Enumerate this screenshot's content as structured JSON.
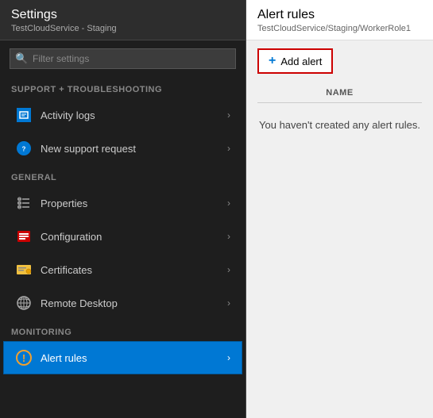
{
  "left_panel": {
    "title": "Settings",
    "subtitle": "TestCloudService - Staging",
    "search": {
      "placeholder": "Filter settings"
    },
    "sections": [
      {
        "label": "SUPPORT + TROUBLESHOOTING",
        "items": [
          {
            "id": "activity-logs",
            "label": "Activity logs",
            "icon": "activity-icon",
            "active": false
          },
          {
            "id": "new-support-request",
            "label": "New support request",
            "icon": "support-icon",
            "active": false
          }
        ]
      },
      {
        "label": "GENERAL",
        "items": [
          {
            "id": "properties",
            "label": "Properties",
            "icon": "properties-icon",
            "active": false
          },
          {
            "id": "configuration",
            "label": "Configuration",
            "icon": "config-icon",
            "active": false
          },
          {
            "id": "certificates",
            "label": "Certificates",
            "icon": "cert-icon",
            "active": false
          },
          {
            "id": "remote-desktop",
            "label": "Remote Desktop",
            "icon": "remote-icon",
            "active": false
          }
        ]
      },
      {
        "label": "MONITORING",
        "items": [
          {
            "id": "alert-rules",
            "label": "Alert rules",
            "icon": "alert-icon",
            "active": true
          }
        ]
      }
    ]
  },
  "right_panel": {
    "title": "Alert rules",
    "subtitle": "TestCloudService/Staging/WorkerRole1",
    "add_button_label": "Add alert",
    "column_header": "NAME",
    "empty_message": "You haven't created any alert rules."
  }
}
